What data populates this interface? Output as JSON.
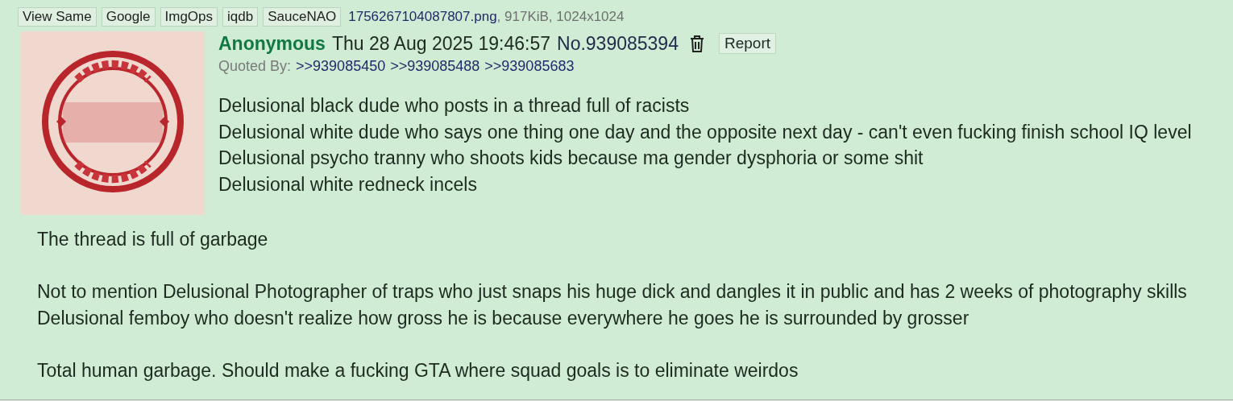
{
  "file_buttons": [
    "View Same",
    "Google",
    "ImgOps",
    "iqdb",
    "SauceNAO"
  ],
  "file": {
    "name": "1756267104087807.png",
    "info": ", 917KiB, 1024x1024"
  },
  "post": {
    "name": "Anonymous",
    "date": "Thu 28 Aug 2025 19:46:57",
    "number": "No.939085394",
    "report": "Report",
    "quoted_by_label": "Quoted By:",
    "quoted_by": [
      ">>939085450",
      ">>939085488",
      ">>939085683"
    ],
    "paragraphs": [
      [
        "Delusional black dude who posts in a thread full of racists",
        "Delusional white dude who says one thing one day and the opposite next day - can't even fucking finish school IQ level",
        "Delusional psycho tranny who shoots kids because ma gender dysphoria or some shit",
        "Delusional white redneck incels"
      ],
      [
        "The thread is full of garbage"
      ],
      [
        "Not to mention Delusional Photographer of traps who just snaps his huge dick and dangles it in public and has 2 weeks of photography skills",
        "Delusional femboy who doesn't realize how gross he is because everywhere he goes he is surrounded by grosser"
      ],
      [
        "Total human garbage. Should make a fucking GTA where squad goals is to eliminate weirdos"
      ]
    ]
  }
}
